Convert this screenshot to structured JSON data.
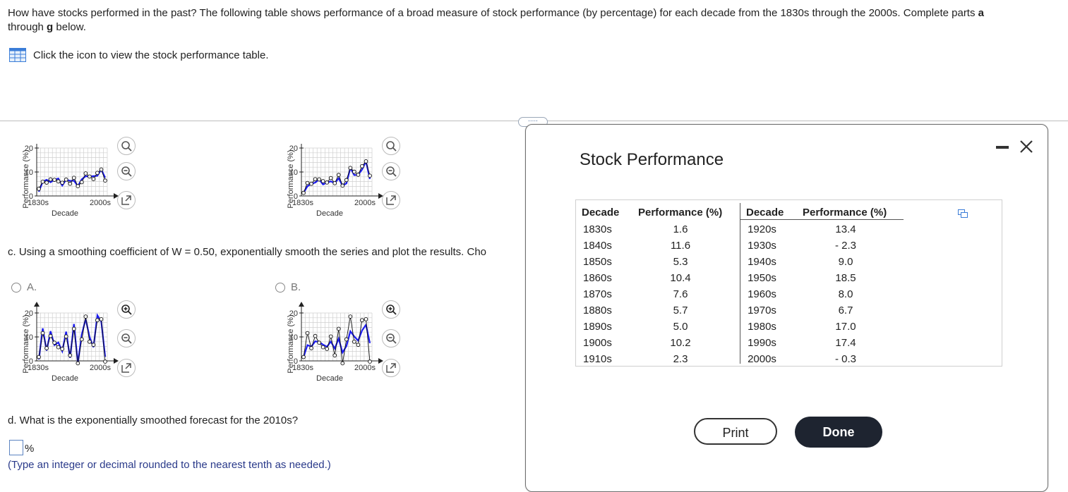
{
  "intro": {
    "part1": "How have stocks performed in the past? The following table shows performance of a broad measure of stock performance (by percentage) for each decade from the 1830s through the 2000s. Complete parts ",
    "bold_a": "a",
    "part2": "through ",
    "bold_g": "g",
    "part3": " below."
  },
  "table_link": {
    "label": "Click the icon to view the stock performance table.",
    "icon": "table-grid-icon"
  },
  "more_button": {
    "label": "....."
  },
  "top_charts": [
    {
      "ylabel": "Performance (%)",
      "xlabel": "Decade",
      "yticks": [
        "20",
        "10",
        "0"
      ],
      "xtick_start": "1830s",
      "xtick_end": "2000s"
    },
    {
      "ylabel": "Performance (%)",
      "xlabel": "Decade",
      "yticks": [
        "20",
        "10",
        "0"
      ],
      "xtick_start": "1830s",
      "xtick_end": "2000s"
    }
  ],
  "question_c": {
    "prefix": "c.",
    "text": " Using a smoothing coefficient of W = 0.50, exponentially smooth the series and plot the results. Cho"
  },
  "options": [
    {
      "letter": "A.",
      "ylabel": "Performance (%)",
      "xlabel": "Decade",
      "yticks": [
        "20",
        "10",
        "0"
      ],
      "xtick_start": "1830s",
      "xtick_end": "2000s"
    },
    {
      "letter": "B.",
      "ylabel": "Performance (%)",
      "xlabel": "Decade",
      "yticks": [
        "20",
        "10",
        "0"
      ],
      "xtick_start": "1830s",
      "xtick_end": "2000s"
    }
  ],
  "question_d": {
    "prefix": "d.",
    "text": " What is the exponentially smoothed forecast for the 2010s?"
  },
  "answer": {
    "value": "",
    "unit": "%",
    "hint": "(Type an integer or decimal rounded to the nearest tenth as needed.)"
  },
  "popup": {
    "title": "Stock Performance",
    "headers": [
      "Decade",
      "Performance (%)",
      "Decade",
      "Performance (%)"
    ],
    "left_rows": [
      [
        "1830s",
        "1.6"
      ],
      [
        "1840s",
        "11.6"
      ],
      [
        "1850s",
        "5.3"
      ],
      [
        "1860s",
        "10.4"
      ],
      [
        "1870s",
        "7.6"
      ],
      [
        "1880s",
        "5.7"
      ],
      [
        "1890s",
        "5.0"
      ],
      [
        "1900s",
        "10.2"
      ],
      [
        "1910s",
        "2.3"
      ]
    ],
    "right_rows": [
      [
        "1920s",
        "13.4"
      ],
      [
        "1930s",
        "- 2.3"
      ],
      [
        "1940s",
        "9.0"
      ],
      [
        "1950s",
        "18.5"
      ],
      [
        "1960s",
        "8.0"
      ],
      [
        "1970s",
        "6.7"
      ],
      [
        "1980s",
        "17.0"
      ],
      [
        "1990s",
        "17.4"
      ],
      [
        "2000s",
        "- 0.3"
      ]
    ],
    "print_label": "Print",
    "done_label": "Done"
  },
  "chart_data": [
    {
      "type": "line",
      "x": [
        "1830s",
        "1840s",
        "1850s",
        "1860s",
        "1870s",
        "1880s",
        "1890s",
        "1900s",
        "1910s",
        "1920s",
        "1930s",
        "1940s",
        "1950s",
        "1960s",
        "1970s",
        "1980s",
        "1990s",
        "2000s"
      ],
      "series": [
        {
          "values": [
            1.6,
            11.6,
            5.3,
            10.4,
            7.6,
            5.7,
            5.0,
            10.2,
            2.3,
            13.4,
            -2.3,
            9.0,
            18.5,
            8.0,
            6.7,
            17.0,
            17.4,
            -0.3
          ]
        }
      ],
      "ylim": [
        0,
        20
      ],
      "xlabel": "Decade",
      "ylabel": "Performance (%)",
      "grid": true
    }
  ]
}
